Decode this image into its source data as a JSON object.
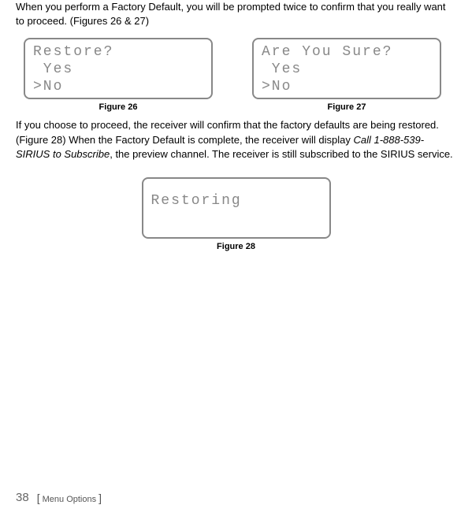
{
  "paragraphs": {
    "p1": "When you perform a Factory Default, you will be prompted twice to confirm that you really want to proceed. (Figures 26 & 27)",
    "p2_part1": "If you choose to proceed, the receiver will confirm that the factory defaults are being restored. (Figure 28) When the Factory Default is complete, the receiver will display ",
    "p2_italic": "Call 1-888-539-SIRIUS to Subscribe",
    "p2_part2": ", the preview channel. The receiver is still subscribed to the SIRIUS service."
  },
  "figures": {
    "fig26": {
      "caption": "Figure 26",
      "lines": {
        "l1": "Restore?",
        "l2": " Yes",
        "l3": ">No"
      }
    },
    "fig27": {
      "caption": "Figure 27",
      "lines": {
        "l1": "Are You Sure?",
        "l2": " Yes",
        "l3": ">No"
      }
    },
    "fig28": {
      "caption": "Figure 28",
      "lines": {
        "l1": "Restoring"
      }
    }
  },
  "footer": {
    "page": "38",
    "bracket_open": "[",
    "section": " Menu Options ",
    "bracket_close": "]"
  }
}
